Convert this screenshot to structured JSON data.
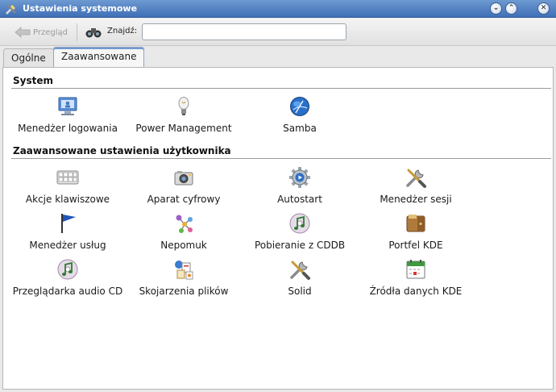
{
  "window": {
    "title": "Ustawienia systemowe"
  },
  "toolbar": {
    "back_label": "Przegląd",
    "find_label": "Znajdź:",
    "search_value": ""
  },
  "tabs": [
    {
      "label": "Ogólne",
      "active": false
    },
    {
      "label": "Zaawansowane",
      "active": true
    }
  ],
  "sections": {
    "system": {
      "title": "System",
      "items": [
        {
          "label": "Menedżer logowania",
          "icon": "monitor-icon"
        },
        {
          "label": "Power Management",
          "icon": "lightbulb-icon"
        },
        {
          "label": "Samba",
          "icon": "globe-icon"
        }
      ]
    },
    "user": {
      "title": "Zaawansowane ustawienia użytkownika",
      "items": [
        {
          "label": "Akcje klawiszowe",
          "icon": "keyboard-icon"
        },
        {
          "label": "Aparat cyfrowy",
          "icon": "camera-icon"
        },
        {
          "label": "Autostart",
          "icon": "gear-icon"
        },
        {
          "label": "Menedżer sesji",
          "icon": "tools-icon"
        },
        {
          "label": "Menedżer usług",
          "icon": "flag-icon"
        },
        {
          "label": "Nepomuk",
          "icon": "nepomuk-icon"
        },
        {
          "label": "Pobieranie z CDDB",
          "icon": "cd-music-icon"
        },
        {
          "label": "Portfel KDE",
          "icon": "wallet-icon"
        },
        {
          "label": "Przeglądarka audio CD",
          "icon": "cd-music-icon"
        },
        {
          "label": "Skojarzenia plików",
          "icon": "file-associations-icon"
        },
        {
          "label": "Solid",
          "icon": "tools-icon"
        },
        {
          "label": "Źródła danych KDE",
          "icon": "calendar-icon"
        }
      ]
    }
  }
}
